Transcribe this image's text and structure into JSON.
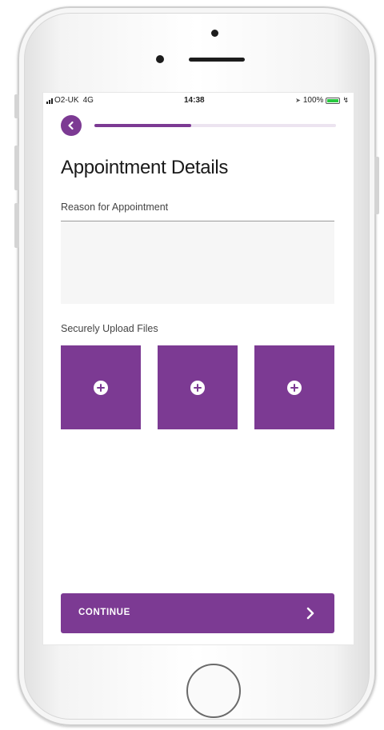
{
  "status_bar": {
    "carrier": "O2-UK",
    "network": "4G",
    "time": "14:38",
    "battery": "100%",
    "icons": [
      "signal-icon",
      "location-icon",
      "battery-icon",
      "bolt-icon"
    ]
  },
  "nav": {
    "back_icon": "chevron-left-icon",
    "progress_fraction": 0.4
  },
  "page": {
    "title": "Appointment Details"
  },
  "reason": {
    "label": "Reason for Appointment",
    "value": "",
    "placeholder": ""
  },
  "upload": {
    "label": "Securely Upload Files",
    "tiles": [
      {
        "icon": "plus-circle-icon"
      },
      {
        "icon": "plus-circle-icon"
      },
      {
        "icon": "plus-circle-icon"
      }
    ]
  },
  "footer": {
    "continue_label": "CONTINUE",
    "continue_icon": "chevron-right-icon"
  },
  "colors": {
    "accent": "#7c3a93",
    "progress_track": "#ece4f0",
    "input_background": "#f6f6f6",
    "background": "#ffffff"
  }
}
